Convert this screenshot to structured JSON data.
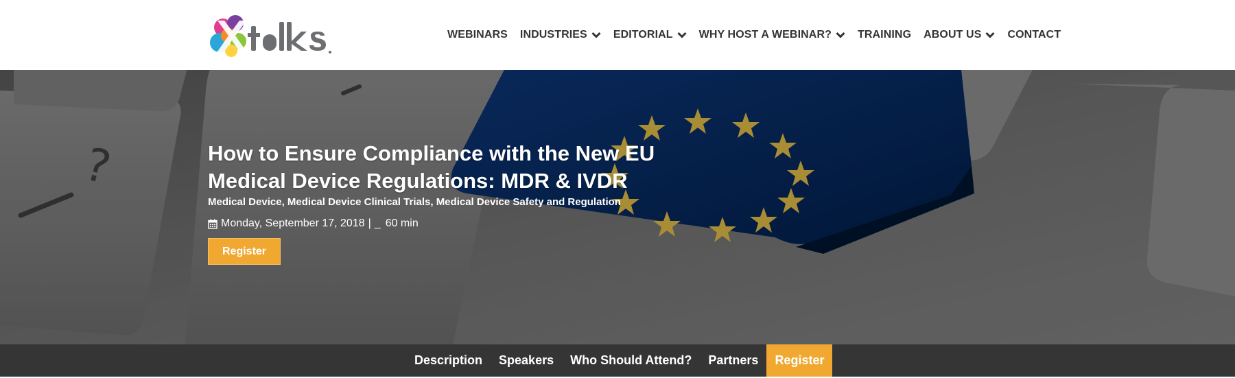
{
  "brand": {
    "logo_text": "Xtalks",
    "accent_color": "#f0a830",
    "header_bg": "#ffffff",
    "tabbar_bg": "#353535"
  },
  "nav": {
    "items": [
      {
        "label": "WEBINARS",
        "has_dropdown": false
      },
      {
        "label": "INDUSTRIES",
        "has_dropdown": true
      },
      {
        "label": "EDITORIAL",
        "has_dropdown": true
      },
      {
        "label": "WHY HOST A WEBINAR?",
        "has_dropdown": true
      },
      {
        "label": "TRAINING",
        "has_dropdown": false
      },
      {
        "label": "ABOUT US",
        "has_dropdown": true
      },
      {
        "label": "CONTACT",
        "has_dropdown": false
      }
    ]
  },
  "hero": {
    "title": "How to Ensure Compliance with the New EU Medical Device Regulations: MDR & IVDR",
    "categories": [
      "Medical Device",
      "Medical Device Clinical Trials",
      "Medical Device Safety and Regulation"
    ],
    "category_separator": ", ",
    "date": "Monday, September 17, 2018",
    "separator": "|",
    "time_placeholder": "_",
    "duration": "60 min",
    "register_label": "Register",
    "icons": [
      "calendar-icon"
    ]
  },
  "tabs": {
    "items": [
      {
        "label": "Description",
        "active": false
      },
      {
        "label": "Speakers",
        "active": false
      },
      {
        "label": "Who Should Attend?",
        "active": false
      },
      {
        "label": "Partners",
        "active": false
      },
      {
        "label": "Register",
        "active": true
      }
    ]
  }
}
